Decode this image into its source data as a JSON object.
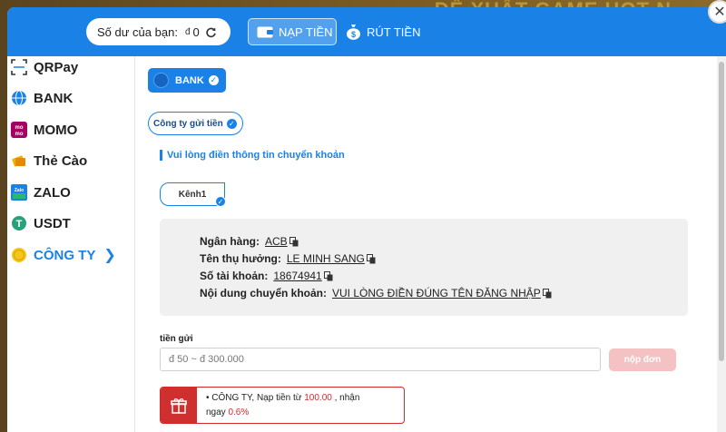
{
  "header": {
    "balance_label": "Số dư của bạn:",
    "currency": "đ",
    "balance_value": "0",
    "tab_deposit": "NẠP TIỀN",
    "tab_withdraw": "RÚT TIỀN"
  },
  "sidebar": {
    "items": [
      {
        "label": "QRPay",
        "icon": "qr-scan-icon"
      },
      {
        "label": "BANK",
        "icon": "globe-icon"
      },
      {
        "label": "MOMO",
        "icon": "momo-icon"
      },
      {
        "label": "Thẻ Cào",
        "icon": "card-icon"
      },
      {
        "label": "ZALO",
        "icon": "zalopay-icon"
      },
      {
        "label": "USDT",
        "icon": "tether-icon"
      },
      {
        "label": "CÔNG TY",
        "icon": "coin-icon",
        "active": true
      }
    ]
  },
  "main": {
    "bank_chip": "BANK",
    "company_chip": "Công ty gửi tiền",
    "note": "Vui lòng điền thông tin chuyển khoản",
    "channel": "Kênh1",
    "info": {
      "bank_label": "Ngân hàng:",
      "bank_value": "ACB",
      "beneficiary_label": "Tên thụ hưởng:",
      "beneficiary_value": "LE MINH SANG",
      "account_label": "Số tài khoản:",
      "account_value": "18674941",
      "content_label": "Nội dung chuyển khoản:",
      "content_value": "VUI LÒNG ĐIỀN ĐÚNG TÊN ĐĂNG NHẬP"
    },
    "amount_label": "tiền gửi",
    "amount_placeholder": "đ 50 ~ đ 300.000",
    "submit_label": "nộp đơn",
    "promo": {
      "bullet": "•",
      "company": "CÔNG TY,",
      "text1": "Nạp tiền từ",
      "min": "100.00",
      "text2": ", nhận",
      "text3": "ngay",
      "rate": "0.6%"
    }
  },
  "background": {
    "banner_text": "ĐỀ XUẤT GAME HOT N"
  },
  "colors": {
    "primary": "#1a82e6",
    "danger": "#cf2f2f",
    "submit_disabled": "#f4c2c2"
  }
}
